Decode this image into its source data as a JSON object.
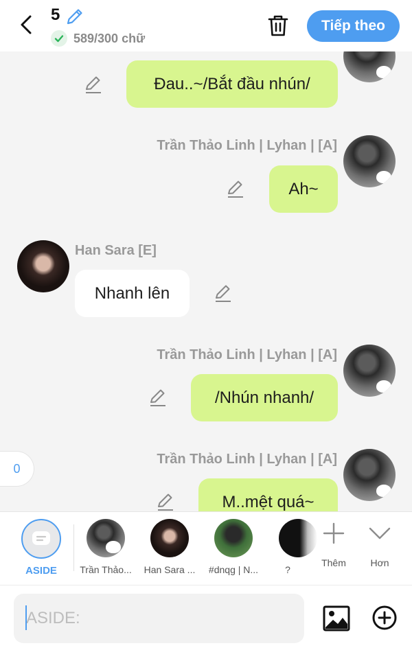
{
  "header": {
    "back_icon": "chevron-left-icon",
    "episode_number": "5",
    "edit_icon": "pencil-icon",
    "word_count": "589/300 chữ",
    "delete_icon": "trash-icon",
    "next_label": "Tiếp theo",
    "accent_color": "#4e9df0"
  },
  "messages": [
    {
      "side": "right",
      "speaker": "",
      "text": "Đau..~/Bắt đầu nhún/"
    },
    {
      "side": "right",
      "speaker": "Trần Thảo Linh | Lyhan | [A]",
      "text": "Ah~"
    },
    {
      "side": "left",
      "speaker": "Han Sara [E]",
      "text": "Nhanh lên"
    },
    {
      "side": "right",
      "speaker": "Trần Thảo Linh | Lyhan | [A]",
      "text": "/Nhún nhanh/"
    },
    {
      "side": "right",
      "speaker": "Trần Thảo Linh | Lyhan | [A]",
      "text": "M..mệt quá~"
    }
  ],
  "side_counter": "0",
  "character_bar": {
    "aside_label": "ASIDE",
    "characters": [
      {
        "name": "Trần Thảo..."
      },
      {
        "name": "Han Sara ..."
      },
      {
        "name": "#dnqg | N..."
      },
      {
        "name": "?"
      }
    ],
    "more_label": "Thêm",
    "expand_label": "Hơn"
  },
  "input": {
    "placeholder": "ASIDE:",
    "value": ""
  },
  "colors": {
    "my_bubble": "#d8f58f",
    "other_bubble": "#ffffff",
    "background": "#f4f4f4"
  }
}
